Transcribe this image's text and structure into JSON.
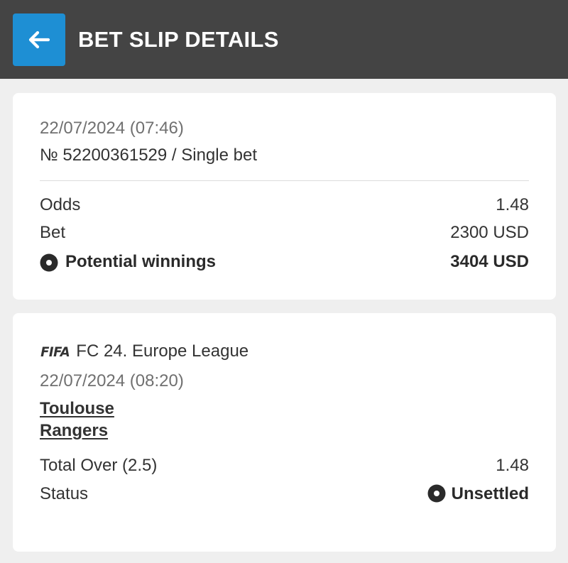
{
  "header": {
    "title": "BET SLIP DETAILS",
    "back_icon": "arrow-left-icon",
    "accent_color": "#1e8fd4",
    "bar_color": "#444444"
  },
  "summary": {
    "datetime": "22/07/2024 (07:46)",
    "bet_id": "№ 52200361529 / Single bet",
    "rows": {
      "odds_label": "Odds",
      "odds_value": "1.48",
      "bet_label": "Bet",
      "bet_value": "2300 USD",
      "winnings_label": "Potential winnings",
      "winnings_value": "3404 USD",
      "winnings_icon": "status-dot-icon"
    }
  },
  "event": {
    "sport_logo": "FIFA",
    "league": "FC 24. Europe League",
    "datetime": "22/07/2024 (08:20)",
    "team_home": "Toulouse",
    "team_away": "Rangers",
    "market_label": "Total Over (2.5)",
    "market_odds": "1.48",
    "status_label": "Status",
    "status_value": "Unsettled",
    "status_icon": "status-dot-icon"
  }
}
